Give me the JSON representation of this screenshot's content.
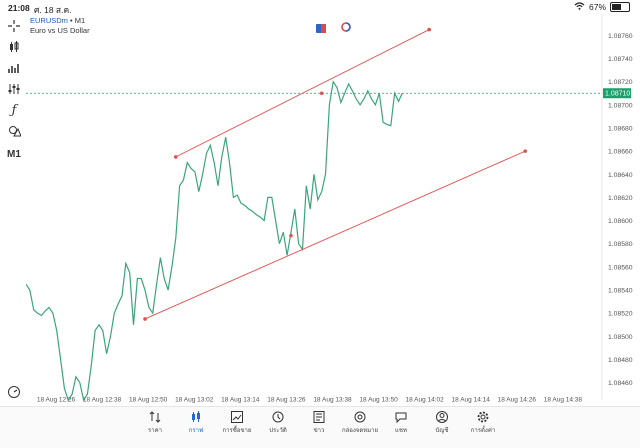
{
  "status_bar": {
    "time": "21:08",
    "date": "ศ. 18 ส.ค.",
    "battery": "67%",
    "battery_level": 0.67
  },
  "symbol": {
    "name": "EURUSDm",
    "timeframe": "M1",
    "description": "Euro vs US Dollar"
  },
  "toolbar": [
    {
      "name": "crosshair-icon",
      "glyph": "+"
    },
    {
      "name": "candles-icon",
      "glyph": "candles"
    },
    {
      "name": "indicators-icon",
      "glyph": "bars"
    },
    {
      "name": "settings-sliders-icon",
      "glyph": "sliders"
    },
    {
      "name": "function-icon",
      "glyph": "ƒ"
    },
    {
      "name": "objects-icon",
      "glyph": "shapes"
    },
    {
      "name": "timeframe-label",
      "label": "M1"
    }
  ],
  "chart_data": {
    "type": "line",
    "price_color": "#3aa57a",
    "channel_color": "#e05050",
    "current_price": "1.08710",
    "current_price_value": 1.0871,
    "current_price_color": "#1aa06b",
    "y_ticks": [
      "1.08760",
      "1.08740",
      "1.08720",
      "1.08700",
      "1.08680",
      "1.08660",
      "1.08640",
      "1.08620",
      "1.08600",
      "1.08580",
      "1.08560",
      "1.08540",
      "1.08520",
      "1.08500",
      "1.08480",
      "1.08460"
    ],
    "x_ticks": [
      "18 Aug 12:26",
      "18 Aug 12:38",
      "18 Aug 12:50",
      "18 Aug 13:02",
      "18 Aug 13:14",
      "18 Aug 13:26",
      "18 Aug 13:38",
      "18 Aug 13:50",
      "18 Aug 14:02",
      "18 Aug 14:14",
      "18 Aug 14:26",
      "18 Aug 14:38"
    ],
    "x_minutes": [
      0,
      1,
      2,
      3,
      4,
      5,
      6,
      7,
      8,
      9,
      10,
      11,
      12,
      13,
      14,
      15,
      16,
      17,
      18,
      19,
      20,
      21,
      22,
      23,
      24,
      25,
      26,
      27,
      28,
      29,
      30,
      31,
      32,
      33,
      34,
      35,
      36,
      37,
      38,
      39,
      40,
      41,
      42,
      43,
      44,
      45,
      46,
      47,
      48,
      49,
      50,
      51,
      52,
      53,
      54,
      55,
      56,
      57,
      58,
      59,
      60,
      61,
      62,
      63,
      64,
      65,
      66,
      67,
      68,
      69,
      70,
      71,
      72,
      73,
      74,
      75,
      76,
      77,
      78,
      79,
      80,
      81,
      82,
      83,
      84,
      85,
      86,
      87,
      88,
      89,
      90,
      91,
      92,
      93,
      94,
      95,
      96,
      97,
      98
    ],
    "prices": [
      1.08545,
      1.0854,
      1.08523,
      1.0852,
      1.08518,
      1.08522,
      1.08525,
      1.0852,
      1.08505,
      1.0848,
      1.08455,
      1.08445,
      1.0845,
      1.08465,
      1.0846,
      1.08445,
      1.0845,
      1.08475,
      1.08505,
      1.0851,
      1.08505,
      1.08485,
      1.085,
      1.0852,
      1.08528,
      1.08535,
      1.08563,
      1.08555,
      1.0851,
      1.0855,
      1.0855,
      1.0854,
      1.08525,
      1.0852,
      1.08545,
      1.08568,
      1.0855,
      1.0854,
      1.0856,
      1.08585,
      1.0863,
      1.08635,
      1.0865,
      1.08645,
      1.08642,
      1.08625,
      1.0864,
      1.08658,
      1.08665,
      1.0865,
      1.0863,
      1.08655,
      1.08672,
      1.0865,
      1.0862,
      1.08622,
      1.08615,
      1.08613,
      1.0861,
      1.08608,
      1.08605,
      1.08603,
      1.086,
      1.0862,
      1.0862,
      1.086,
      1.0858,
      1.0859,
      1.0857,
      1.0859,
      1.0861,
      1.0858,
      1.08575,
      1.0863,
      1.0861,
      1.0864,
      1.08618,
      1.08625,
      1.0864,
      1.087,
      1.0872,
      1.08715,
      1.08702,
      1.0871,
      1.08718,
      1.08712,
      1.08705,
      1.087,
      1.08705,
      1.08712,
      1.08705,
      1.087,
      1.0871,
      1.08685,
      1.08683,
      1.08682,
      1.0871,
      1.08703,
      1.0871
    ],
    "channel_upper": [
      {
        "x": 39,
        "y": 1.08655
      },
      {
        "x": 77,
        "y": 1.0871
      },
      {
        "x": 105,
        "y": 1.08765
      }
    ],
    "channel_lower": [
      {
        "x": 31,
        "y": 1.08515
      },
      {
        "x": 69,
        "y": 1.08587
      },
      {
        "x": 130,
        "y": 1.0866
      }
    ],
    "ylim": [
      1.08445,
      1.08775
    ],
    "xlim": [
      0,
      150
    ]
  },
  "bottom_nav": [
    {
      "name": "nav-quotes",
      "icon": "quotes-icon",
      "label": "ราคา",
      "active": false
    },
    {
      "name": "nav-chart",
      "icon": "chart-icon",
      "label": "กราฟ",
      "active": true
    },
    {
      "name": "nav-trade",
      "icon": "trade-icon",
      "label": "การซื้อขาย",
      "active": false
    },
    {
      "name": "nav-history",
      "icon": "history-icon",
      "label": "ประวัติ",
      "active": false
    },
    {
      "name": "nav-news",
      "icon": "news-icon",
      "label": "ข่าว",
      "active": false
    },
    {
      "name": "nav-mailbox",
      "icon": "mailbox-icon",
      "label": "กล่องจดหมาย",
      "active": false
    },
    {
      "name": "nav-chat",
      "icon": "chat-icon",
      "label": "แชท",
      "active": false
    },
    {
      "name": "nav-account",
      "icon": "account-icon",
      "label": "บัญชี",
      "active": false
    },
    {
      "name": "nav-settings",
      "icon": "settings-icon",
      "label": "การตั้งค่า",
      "active": false
    }
  ]
}
